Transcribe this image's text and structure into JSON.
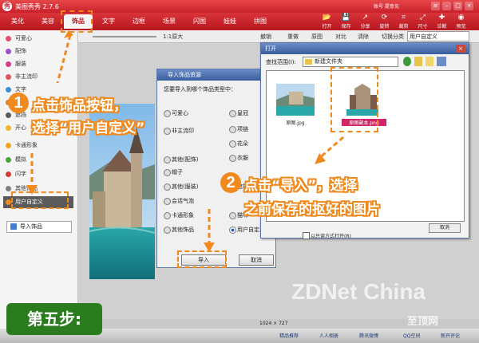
{
  "app": {
    "title": "美图秀秀 2.7.6",
    "logo": "秀"
  },
  "top_links": "账号  提意见",
  "tabs": [
    "美化",
    "美容",
    "饰品",
    "文字",
    "边框",
    "场景",
    "闪图",
    "娃娃",
    "拼图"
  ],
  "toolbar_buttons": [
    {
      "label": "打开",
      "icon": "folder-icon",
      "glyph": "📂"
    },
    {
      "label": "保存",
      "icon": "save-icon",
      "glyph": "💾"
    },
    {
      "label": "分享",
      "icon": "share-icon",
      "glyph": "↗"
    },
    {
      "label": "旋转",
      "icon": "rotate-icon",
      "glyph": "⟳"
    },
    {
      "label": "裁剪",
      "icon": "crop-icon",
      "glyph": "⌗"
    },
    {
      "label": "尺寸",
      "icon": "resize-icon",
      "glyph": "⤢"
    },
    {
      "label": "诊断",
      "icon": "diagnose-icon",
      "glyph": "✚"
    },
    {
      "label": "预览",
      "icon": "preview-icon",
      "glyph": "◉"
    }
  ],
  "toolbar2": {
    "zoom": "1:1原大",
    "undo": "撤销",
    "redo": "重做",
    "original": "原图",
    "compare": "对比",
    "clear": "清除",
    "category_label": "切换分类",
    "category_value": "用户自定义"
  },
  "sidebar": {
    "items": [
      {
        "label": "可爱心",
        "color": "#e94b6c"
      },
      {
        "label": "配饰",
        "color": "#9b4fc9"
      },
      {
        "label": "服装",
        "color": "#d83b8a"
      },
      {
        "label": "非主流印",
        "color": "#e0555b"
      },
      {
        "label": "文字",
        "color": "#3a8ed8"
      },
      {
        "label": "涂鸦",
        "color": "#e57c1f"
      },
      {
        "label": "遮挡",
        "color": "#5b5b5b"
      },
      {
        "label": "开心",
        "color": "#f2b625"
      },
      {
        "label": "卡通形象",
        "color": "#f2a21d"
      },
      {
        "label": "模拟",
        "color": "#49a33b"
      },
      {
        "label": "闪字",
        "color": "#d43c2c"
      },
      {
        "label": "其他饰品",
        "color": "#7f7f7f"
      },
      {
        "label": "用户自定义",
        "color": "#f08a1e"
      }
    ],
    "import_button": "导入饰品"
  },
  "import_dialog": {
    "title": "导入饰品资源",
    "prompt": "您要导入到哪个饰品类型中：",
    "options_left": [
      "可爱心",
      "非主流印",
      "其他(配饰)",
      "帽子",
      "其他(服装)",
      "会话气泡",
      "卡通形象",
      "其他饰品"
    ],
    "options_right": [
      "皇冠",
      "项链",
      "花朵",
      "衣服",
      "遮挡物",
      "猫咪",
      "用户自定义"
    ],
    "selected": "用户自定义",
    "import_button": "导入",
    "cancel_button": "取消"
  },
  "open_dialog": {
    "title": "打开",
    "look_in_label": "查找范围(I):",
    "look_in_value": "新建文件夹",
    "files": [
      {
        "name": "原图.jpg",
        "selected": false
      },
      {
        "name": "原图副本.png",
        "selected": true
      }
    ],
    "cancel_button": "取消",
    "readonly_label": "以只读方式打开(R)"
  },
  "photo_size": "1024 × 727",
  "status_bar": [
    "精品推荐",
    "人人相册",
    "腾讯微博",
    "QQ空间",
    "新开评论"
  ],
  "annotations": {
    "step1_number": "1",
    "step1_line1": "点击饰品按钮，",
    "step1_line2": "选择“用户自定义”",
    "step2_number": "2",
    "step2_line1": "点击“导入”，选择",
    "step2_line2": "之前保存的抠好的图片",
    "step_label": "第五步:"
  },
  "watermark": "ZDNet China",
  "watermark_sub": "至顶网",
  "colors": {
    "brand_red": "#d0232b",
    "annotation_orange": "#f08a1e",
    "step_green": "#2a7c1f"
  }
}
